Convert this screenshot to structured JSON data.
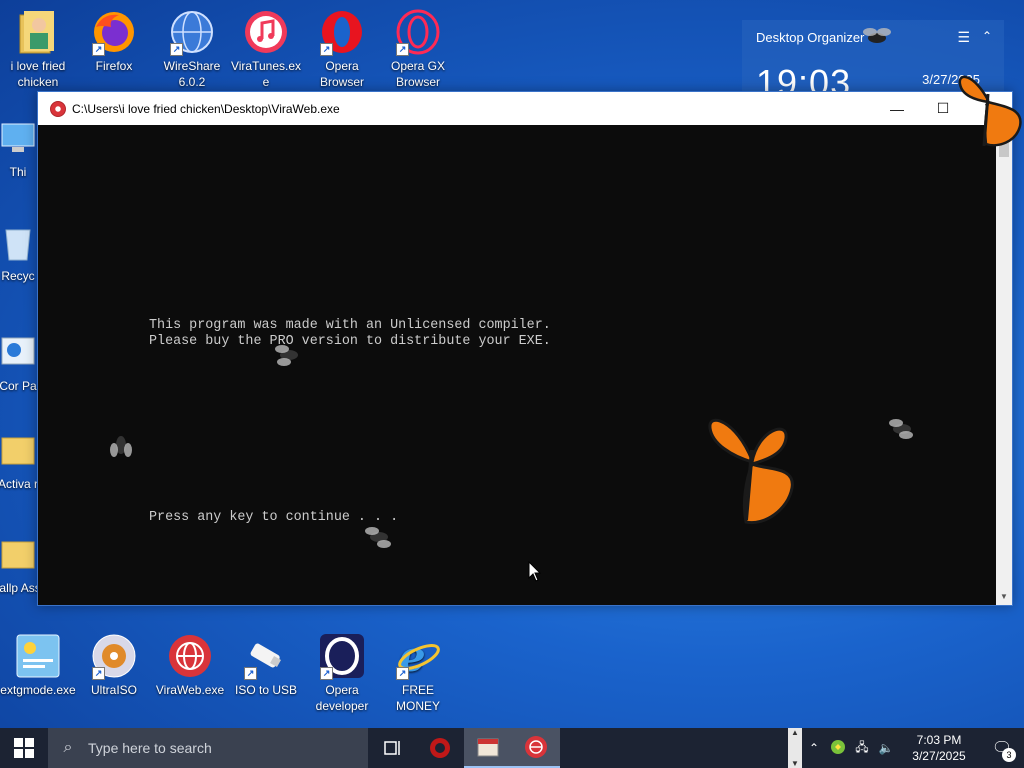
{
  "desktop": {
    "top_icons": [
      {
        "label": "i love fried chicken",
        "icon": "folder-person-icon"
      },
      {
        "label": "Firefox",
        "icon": "firefox-icon"
      },
      {
        "label": "WireShare 6.0.2",
        "icon": "globe-icon"
      },
      {
        "label": "ViraTunes.exe",
        "icon": "music-icon"
      },
      {
        "label": "Opera Browser",
        "icon": "opera-icon"
      },
      {
        "label": "Opera GX Browser",
        "icon": "opera-gx-icon"
      }
    ],
    "left_icons_partial": [
      {
        "label": "Thi",
        "icon": "computer-icon"
      },
      {
        "label": "Recyc",
        "icon": "recycle-bin-icon"
      },
      {
        "label": "Cor Pa",
        "icon": "control-panel-icon"
      },
      {
        "label": "Activa r",
        "icon": "folder-icon"
      },
      {
        "label": "Wallp Assa",
        "icon": "folder-icon"
      }
    ],
    "bottom_icons": [
      {
        "label": "extgmode.exe",
        "icon": "app-window-icon"
      },
      {
        "label": "UltraISO",
        "icon": "disc-icon"
      },
      {
        "label": "ViraWeb.exe",
        "icon": "viraweb-icon"
      },
      {
        "label": "ISO to USB",
        "icon": "usb-icon"
      },
      {
        "label": "Opera developer",
        "icon": "opera-dev-icon"
      },
      {
        "label": "FREE MONEY",
        "icon": "internet-explorer-icon"
      }
    ]
  },
  "widget": {
    "title": "Desktop Organizer",
    "time": "19:03",
    "date": "3/27/2025"
  },
  "window": {
    "title": "C:\\Users\\i love fried chicken\\Desktop\\ViraWeb.exe",
    "line1": "This program was made with an Unlicensed compiler.",
    "line2": "Please buy the PRO version to distribute your EXE.",
    "line3": "Press any key to continue . . ."
  },
  "taskbar": {
    "search_placeholder": "Type here to search",
    "time": "7:03 PM",
    "date": "3/27/2025",
    "notification_count": "3"
  }
}
